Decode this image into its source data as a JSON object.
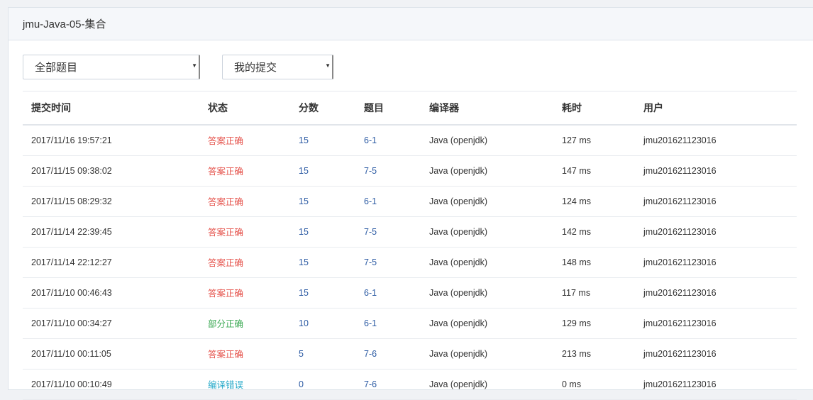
{
  "panel": {
    "title": "jmu-Java-05-集合"
  },
  "filters": {
    "problem_select": {
      "value": "全部题目"
    },
    "submission_select": {
      "value": "我的提交"
    }
  },
  "table": {
    "headers": {
      "time": "提交时间",
      "status": "状态",
      "score": "分数",
      "problem": "题目",
      "compiler": "编译器",
      "cost": "耗时",
      "user": "用户"
    },
    "rows": [
      {
        "time": "2017/11/16 19:57:21",
        "status": "答案正确",
        "status_color": "red",
        "score": "15",
        "problem": "6-1",
        "compiler": "Java (openjdk)",
        "cost": "127 ms",
        "user": "jmu201621123016"
      },
      {
        "time": "2017/11/15 09:38:02",
        "status": "答案正确",
        "status_color": "red",
        "score": "15",
        "problem": "7-5",
        "compiler": "Java (openjdk)",
        "cost": "147 ms",
        "user": "jmu201621123016"
      },
      {
        "time": "2017/11/15 08:29:32",
        "status": "答案正确",
        "status_color": "red",
        "score": "15",
        "problem": "6-1",
        "compiler": "Java (openjdk)",
        "cost": "124 ms",
        "user": "jmu201621123016"
      },
      {
        "time": "2017/11/14 22:39:45",
        "status": "答案正确",
        "status_color": "red",
        "score": "15",
        "problem": "7-5",
        "compiler": "Java (openjdk)",
        "cost": "142 ms",
        "user": "jmu201621123016"
      },
      {
        "time": "2017/11/14 22:12:27",
        "status": "答案正确",
        "status_color": "red",
        "score": "15",
        "problem": "7-5",
        "compiler": "Java (openjdk)",
        "cost": "148 ms",
        "user": "jmu201621123016"
      },
      {
        "time": "2017/11/10 00:46:43",
        "status": "答案正确",
        "status_color": "red",
        "score": "15",
        "problem": "6-1",
        "compiler": "Java (openjdk)",
        "cost": "117 ms",
        "user": "jmu201621123016"
      },
      {
        "time": "2017/11/10 00:34:27",
        "status": "部分正确",
        "status_color": "green",
        "score": "10",
        "problem": "6-1",
        "compiler": "Java (openjdk)",
        "cost": "129 ms",
        "user": "jmu201621123016"
      },
      {
        "time": "2017/11/10 00:11:05",
        "status": "答案正确",
        "status_color": "red",
        "score": "5",
        "problem": "7-6",
        "compiler": "Java (openjdk)",
        "cost": "213 ms",
        "user": "jmu201621123016"
      },
      {
        "time": "2017/11/10 00:10:49",
        "status": "编译错误",
        "status_color": "cyan",
        "score": "0",
        "problem": "7-6",
        "compiler": "Java (openjdk)",
        "cost": "0 ms",
        "user": "jmu201621123016"
      }
    ]
  },
  "colors": {
    "red": "#e5514a",
    "green": "#3aa852",
    "cyan": "#26a9c9",
    "link": "#2b5aa3"
  }
}
